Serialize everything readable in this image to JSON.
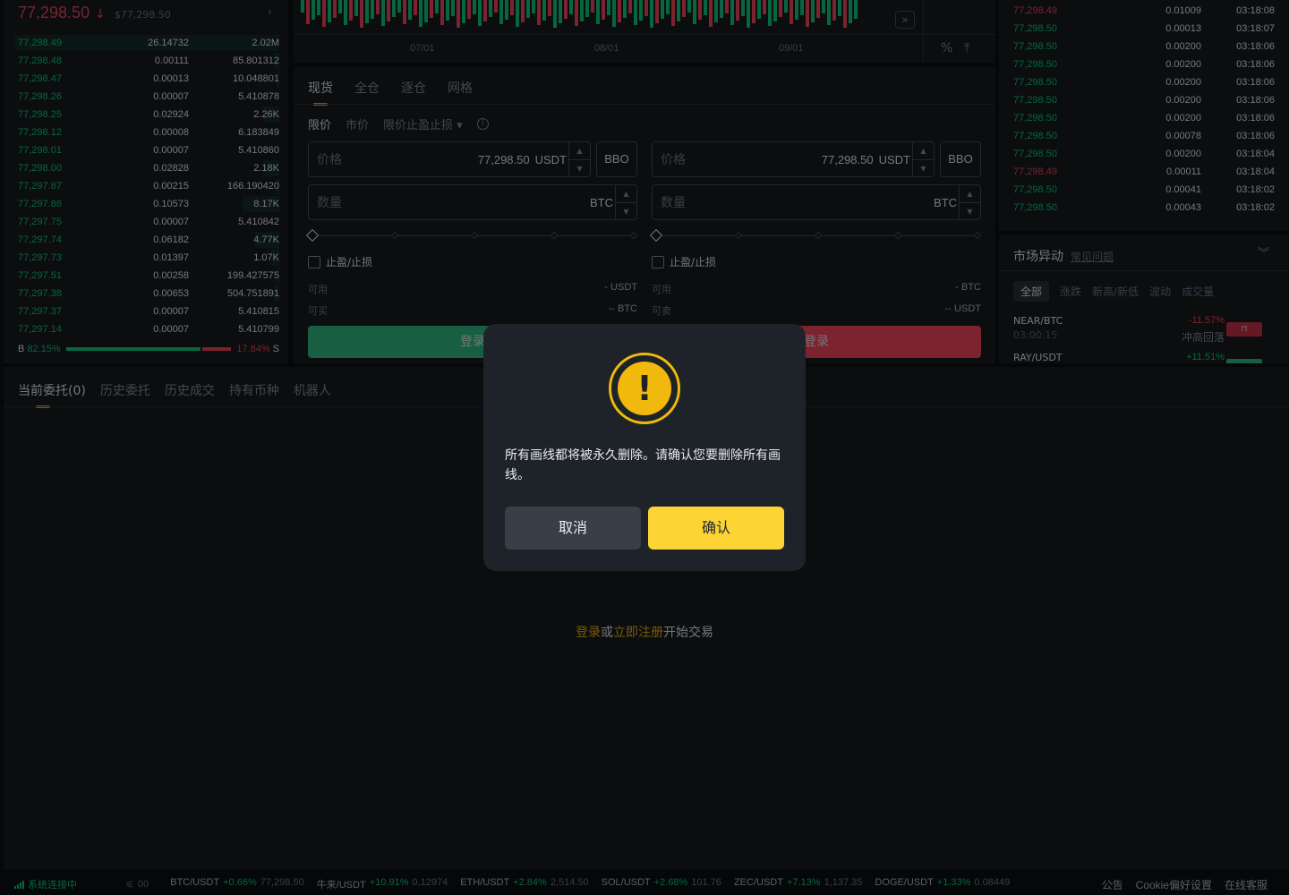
{
  "orderbook": {
    "last_price": "77,298.50",
    "arrow": "↓",
    "usd_price": "$77,298.50",
    "more_icon": "chevron-right-icon",
    "rows": [
      {
        "price": "77,298.49",
        "qty": "26.14732",
        "total": "2.02M"
      },
      {
        "price": "77,298.48",
        "qty": "0.00111",
        "total": "85.801312"
      },
      {
        "price": "77,298.47",
        "qty": "0.00013",
        "total": "10.048801"
      },
      {
        "price": "77,298.26",
        "qty": "0.00007",
        "total": "5.410878"
      },
      {
        "price": "77,298.25",
        "qty": "0.02924",
        "total": "2.26K"
      },
      {
        "price": "77,298.12",
        "qty": "0.00008",
        "total": "6.183849"
      },
      {
        "price": "77,298.01",
        "qty": "0.00007",
        "total": "5.410860"
      },
      {
        "price": "77,298.00",
        "qty": "0.02828",
        "total": "2.18K"
      },
      {
        "price": "77,297.87",
        "qty": "0.00215",
        "total": "166.190420"
      },
      {
        "price": "77,297.86",
        "qty": "0.10573",
        "total": "8.17K"
      },
      {
        "price": "77,297.75",
        "qty": "0.00007",
        "total": "5.410842"
      },
      {
        "price": "77,297.74",
        "qty": "0.06182",
        "total": "4.77K"
      },
      {
        "price": "77,297.73",
        "qty": "0.01397",
        "total": "1.07K"
      },
      {
        "price": "77,297.51",
        "qty": "0.00258",
        "total": "199.427575"
      },
      {
        "price": "77,297.38",
        "qty": "0.00653",
        "total": "504.751891"
      },
      {
        "price": "77,297.37",
        "qty": "0.00007",
        "total": "5.410815"
      },
      {
        "price": "77,297.14",
        "qty": "0.00007",
        "total": "5.410799"
      }
    ],
    "ratio": {
      "b_label": "B",
      "buy_pct": "82.15%",
      "sell_pct": "17.84%",
      "s_label": "S",
      "buy_fraction": 0.8215
    }
  },
  "chart": {
    "dates": [
      "07/01",
      "08/01",
      "09/01"
    ],
    "expand_icon": "double-chevron-right-icon",
    "tools": [
      "%",
      "⤒"
    ],
    "colors": {
      "up": "#0ecb81",
      "down": "#f6465d"
    }
  },
  "trade": {
    "tabs": [
      "现货",
      "全仓",
      "逐仓",
      "网格"
    ],
    "order_types": [
      "限价",
      "市价",
      "限价止盈止损 ▾"
    ],
    "buy": {
      "price_label": "价格",
      "price_value": "77,298.50",
      "price_unit": "USDT",
      "bbo": "BBO",
      "qty_label": "数量",
      "qty_unit": "BTC",
      "tpsl": "止盈/止损",
      "avail_label": "可用",
      "avail_value": "- USDT",
      "max_label": "可买",
      "max_value": "-- BTC",
      "button": "登录"
    },
    "sell": {
      "price_label": "价格",
      "price_value": "77,298.50",
      "price_unit": "USDT",
      "bbo": "BBO",
      "qty_label": "数量",
      "qty_unit": "BTC",
      "tpsl": "止盈/止损",
      "avail_label": "可用",
      "avail_value": "- BTC",
      "max_label": "可卖",
      "max_value": "-- USDT",
      "button": "登录"
    }
  },
  "trades": [
    {
      "price": "77,298.49",
      "qty": "0.01009",
      "time": "03:18:08",
      "side": "sell"
    },
    {
      "price": "77,298.50",
      "qty": "0.00013",
      "time": "03:18:07",
      "side": "buy"
    },
    {
      "price": "77,298.50",
      "qty": "0.00200",
      "time": "03:18:06",
      "side": "buy"
    },
    {
      "price": "77,298.50",
      "qty": "0.00200",
      "time": "03:18:06",
      "side": "buy"
    },
    {
      "price": "77,298.50",
      "qty": "0.00200",
      "time": "03:18:06",
      "side": "buy"
    },
    {
      "price": "77,298.50",
      "qty": "0.00200",
      "time": "03:18:06",
      "side": "buy"
    },
    {
      "price": "77,298.50",
      "qty": "0.00200",
      "time": "03:18:06",
      "side": "buy"
    },
    {
      "price": "77,298.50",
      "qty": "0.00078",
      "time": "03:18:06",
      "side": "buy"
    },
    {
      "price": "77,298.50",
      "qty": "0.00200",
      "time": "03:18:04",
      "side": "buy"
    },
    {
      "price": "77,298.49",
      "qty": "0.00011",
      "time": "03:18:04",
      "side": "sell"
    },
    {
      "price": "77,298.50",
      "qty": "0.00041",
      "time": "03:18:02",
      "side": "buy"
    },
    {
      "price": "77,298.50",
      "qty": "0.00043",
      "time": "03:18:02",
      "side": "buy"
    }
  ],
  "movers": {
    "title": "市场异动",
    "faq": "常见问题",
    "tabs": [
      "全部",
      "涨跌",
      "新高/新低",
      "波动",
      "成交量"
    ],
    "items": [
      {
        "symbol": "NEAR/BTC",
        "time": "03:00:15",
        "change": "-11.57%",
        "kind": "冲高回落",
        "dir": "down"
      },
      {
        "symbol": "RAY/USDT",
        "time": "",
        "change": "+11.51%",
        "kind": "",
        "dir": "up"
      }
    ]
  },
  "orders": {
    "tabs": [
      "当前委托(0)",
      "历史委托",
      "历史成交",
      "持有币种",
      "机器人"
    ],
    "login_link": "登录",
    "or": "或",
    "register_link": "立即注册",
    "suffix": "开始交易"
  },
  "footer": {
    "status": "系统连接中",
    "ping": "00",
    "tickers": [
      {
        "pair": "BTC/USDT",
        "change": "+0.66%",
        "price": "77,298.50"
      },
      {
        "pair": "牛来/USDT",
        "change": "+10.91%",
        "price": "0.12974"
      },
      {
        "pair": "ETH/USDT",
        "change": "+2.84%",
        "price": "2,514.50"
      },
      {
        "pair": "SOL/USDT",
        "change": "+2.68%",
        "price": "101.76"
      },
      {
        "pair": "ZEC/USDT",
        "change": "+7.13%",
        "price": "1,137.35"
      },
      {
        "pair": "DOGE/USDT",
        "change": "+1.33%",
        "price": "0.08449"
      }
    ],
    "links": [
      "公告",
      "Cookie偏好设置",
      "在线客服"
    ]
  },
  "modal": {
    "icon": "warning-icon",
    "icon_glyph": "!",
    "message": "所有画线都将被永久删除。请确认您要删除所有画线。",
    "cancel": "取消",
    "confirm": "确认"
  }
}
